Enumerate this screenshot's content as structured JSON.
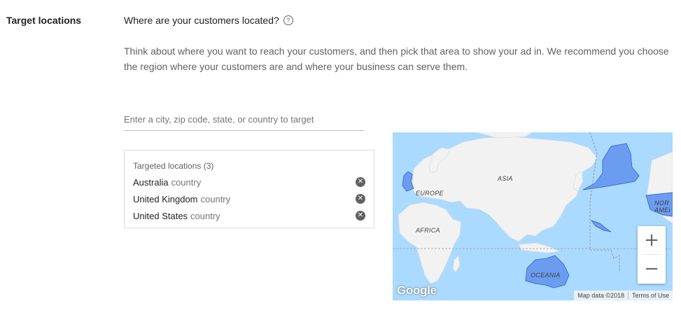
{
  "section": {
    "label": "Target locations"
  },
  "question": {
    "text": "Where are your customers located?",
    "help_icon": "?"
  },
  "description": "Think about where you want to reach your customers, and then pick that area to show your ad in. We recommend you choose the region where your customers are and where your business can serve them.",
  "search": {
    "placeholder": "Enter a city, zip code, state, or country to target",
    "value": ""
  },
  "targeted": {
    "header": "Targeted locations (3)",
    "items": [
      {
        "name": "Australia",
        "type": "country"
      },
      {
        "name": "United Kingdom",
        "type": "country"
      },
      {
        "name": "United States",
        "type": "country"
      }
    ],
    "remove_glyph": "✕"
  },
  "map": {
    "labels": {
      "europe": "EUROPE",
      "asia": "ASIA",
      "africa": "AFRICA",
      "oceania": "OCEANIA",
      "north_america": "NORTH AMERICA"
    },
    "zoom_in": "+",
    "zoom_out": "−",
    "logo": "Google",
    "attribution": "Map data ©2018",
    "terms": "Terms of Use",
    "colors": {
      "water": "#aadaff",
      "land": "#f2f2f2",
      "highlight": "#6b9cf0",
      "highlight_stroke": "#3f6fd8"
    }
  }
}
